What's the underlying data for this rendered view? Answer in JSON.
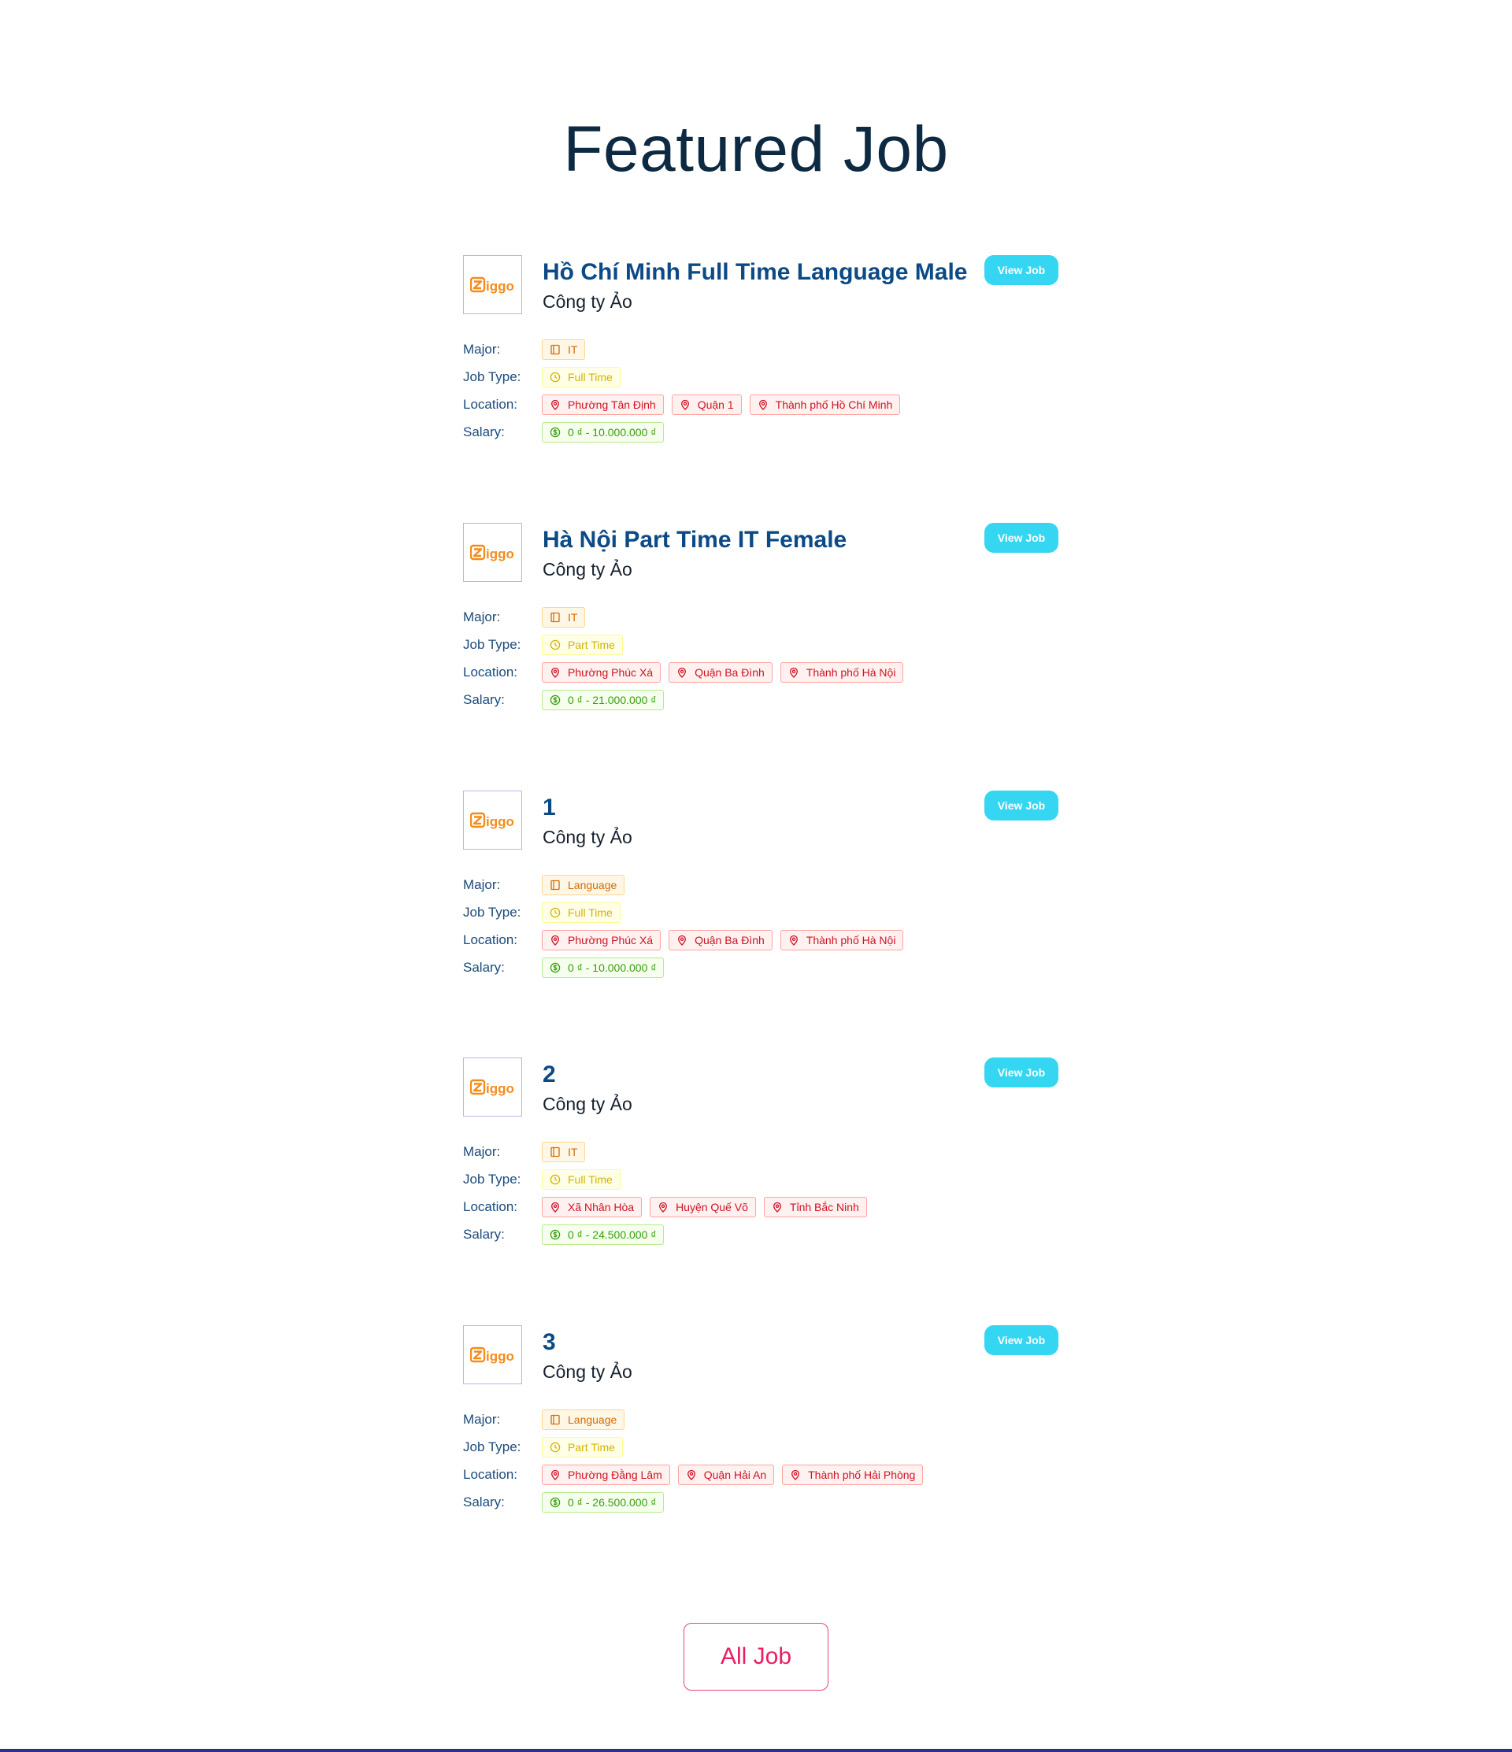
{
  "page_title": "Featured Job",
  "labels": {
    "major": "Major:",
    "job_type": "Job Type:",
    "location": "Location:",
    "salary": "Salary:"
  },
  "logo_text": "Ziggo",
  "view_job_label": "View Job",
  "all_job_label": "All Job",
  "colors": {
    "title": "#0e2a42",
    "job_title": "#0c4a86",
    "view_button": "#35d6f2",
    "all_job_button": "#e91e63",
    "logo": "#f48c1c"
  },
  "jobs": [
    {
      "title": "Hồ Chí Minh Full Time Language Male",
      "company": "Công ty Ảo",
      "major": "IT",
      "job_type": "Full Time",
      "locations": [
        "Phường Tân Định",
        "Quận 1",
        "Thành phố Hồ Chí Minh"
      ],
      "salary": "0 ₫ - 10.000.000 ₫"
    },
    {
      "title": "Hà Nội Part Time IT Female",
      "company": "Công ty Ảo",
      "major": "IT",
      "job_type": "Part Time",
      "locations": [
        "Phường Phúc Xá",
        "Quận Ba Đình",
        "Thành phố Hà Nội"
      ],
      "salary": "0 ₫ - 21.000.000 ₫"
    },
    {
      "title": "1",
      "company": "Công ty Ảo",
      "major": "Language",
      "job_type": "Full Time",
      "locations": [
        "Phường Phúc Xá",
        "Quận Ba Đình",
        "Thành phố Hà Nội"
      ],
      "salary": "0 ₫ - 10.000.000 ₫"
    },
    {
      "title": "2",
      "company": "Công ty Ảo",
      "major": "IT",
      "job_type": "Full Time",
      "locations": [
        "Xã Nhân Hòa",
        "Huyện Quế Võ",
        "Tỉnh Bắc Ninh"
      ],
      "salary": "0 ₫ - 24.500.000 ₫"
    },
    {
      "title": "3",
      "company": "Công ty Ảo",
      "major": "Language",
      "job_type": "Part Time",
      "locations": [
        "Phường Đằng Lâm",
        "Quận Hải An",
        "Thành phố Hải Phòng"
      ],
      "salary": "0 ₫ - 26.500.000 ₫"
    }
  ]
}
